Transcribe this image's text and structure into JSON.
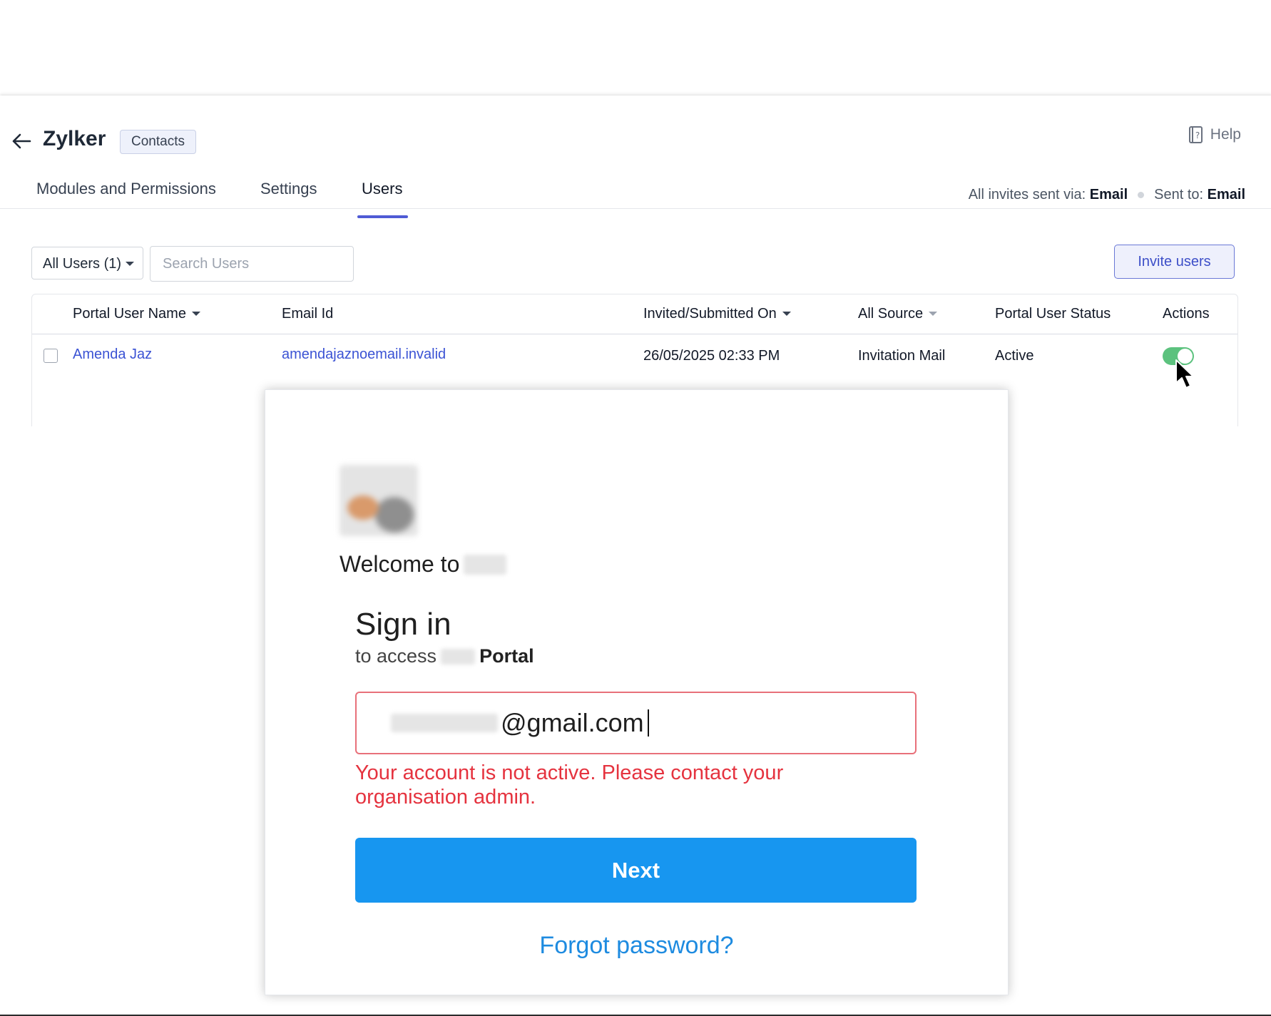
{
  "admin": {
    "app_name": "Zylker",
    "module_chip": "Contacts",
    "help_label": "Help",
    "tabs": [
      {
        "label": "Modules and Permissions",
        "active": false
      },
      {
        "label": "Settings",
        "active": false
      },
      {
        "label": "Users",
        "active": true
      }
    ],
    "invite_info": {
      "via_label": "All invites sent via:",
      "via_value": "Email",
      "to_label": "Sent to:",
      "to_value": "Email"
    },
    "filter_label": "All Users (1)",
    "search_placeholder": "Search Users",
    "invite_button": "Invite users",
    "table": {
      "columns": [
        "Portal User Name",
        "Email Id",
        "Invited/Submitted On",
        "All Source",
        "Portal User Status",
        "Actions"
      ],
      "rows": [
        {
          "name": "Amenda Jaz",
          "email": "amendajaznoemail.invalid",
          "invited_on": "26/05/2025 02:33 PM",
          "source": "Invitation Mail",
          "status": "Active",
          "toggle_on": true
        }
      ]
    },
    "colors": {
      "accent": "#4f5bd5",
      "link": "#3b53d4",
      "toggle_on": "#5cc27e"
    }
  },
  "signin": {
    "welcome": "Welcome to",
    "title": "Sign in",
    "subtitle_prefix": "to access",
    "subtitle_portal": "Portal",
    "email_suffix": "@gmail.com",
    "error": "Your account is not active. Please contact your organisation admin.",
    "next_button": "Next",
    "forgot_link": "Forgot password?",
    "colors": {
      "error": "#e5333f",
      "primary": "#1796f0",
      "link": "#1e8be0"
    }
  }
}
